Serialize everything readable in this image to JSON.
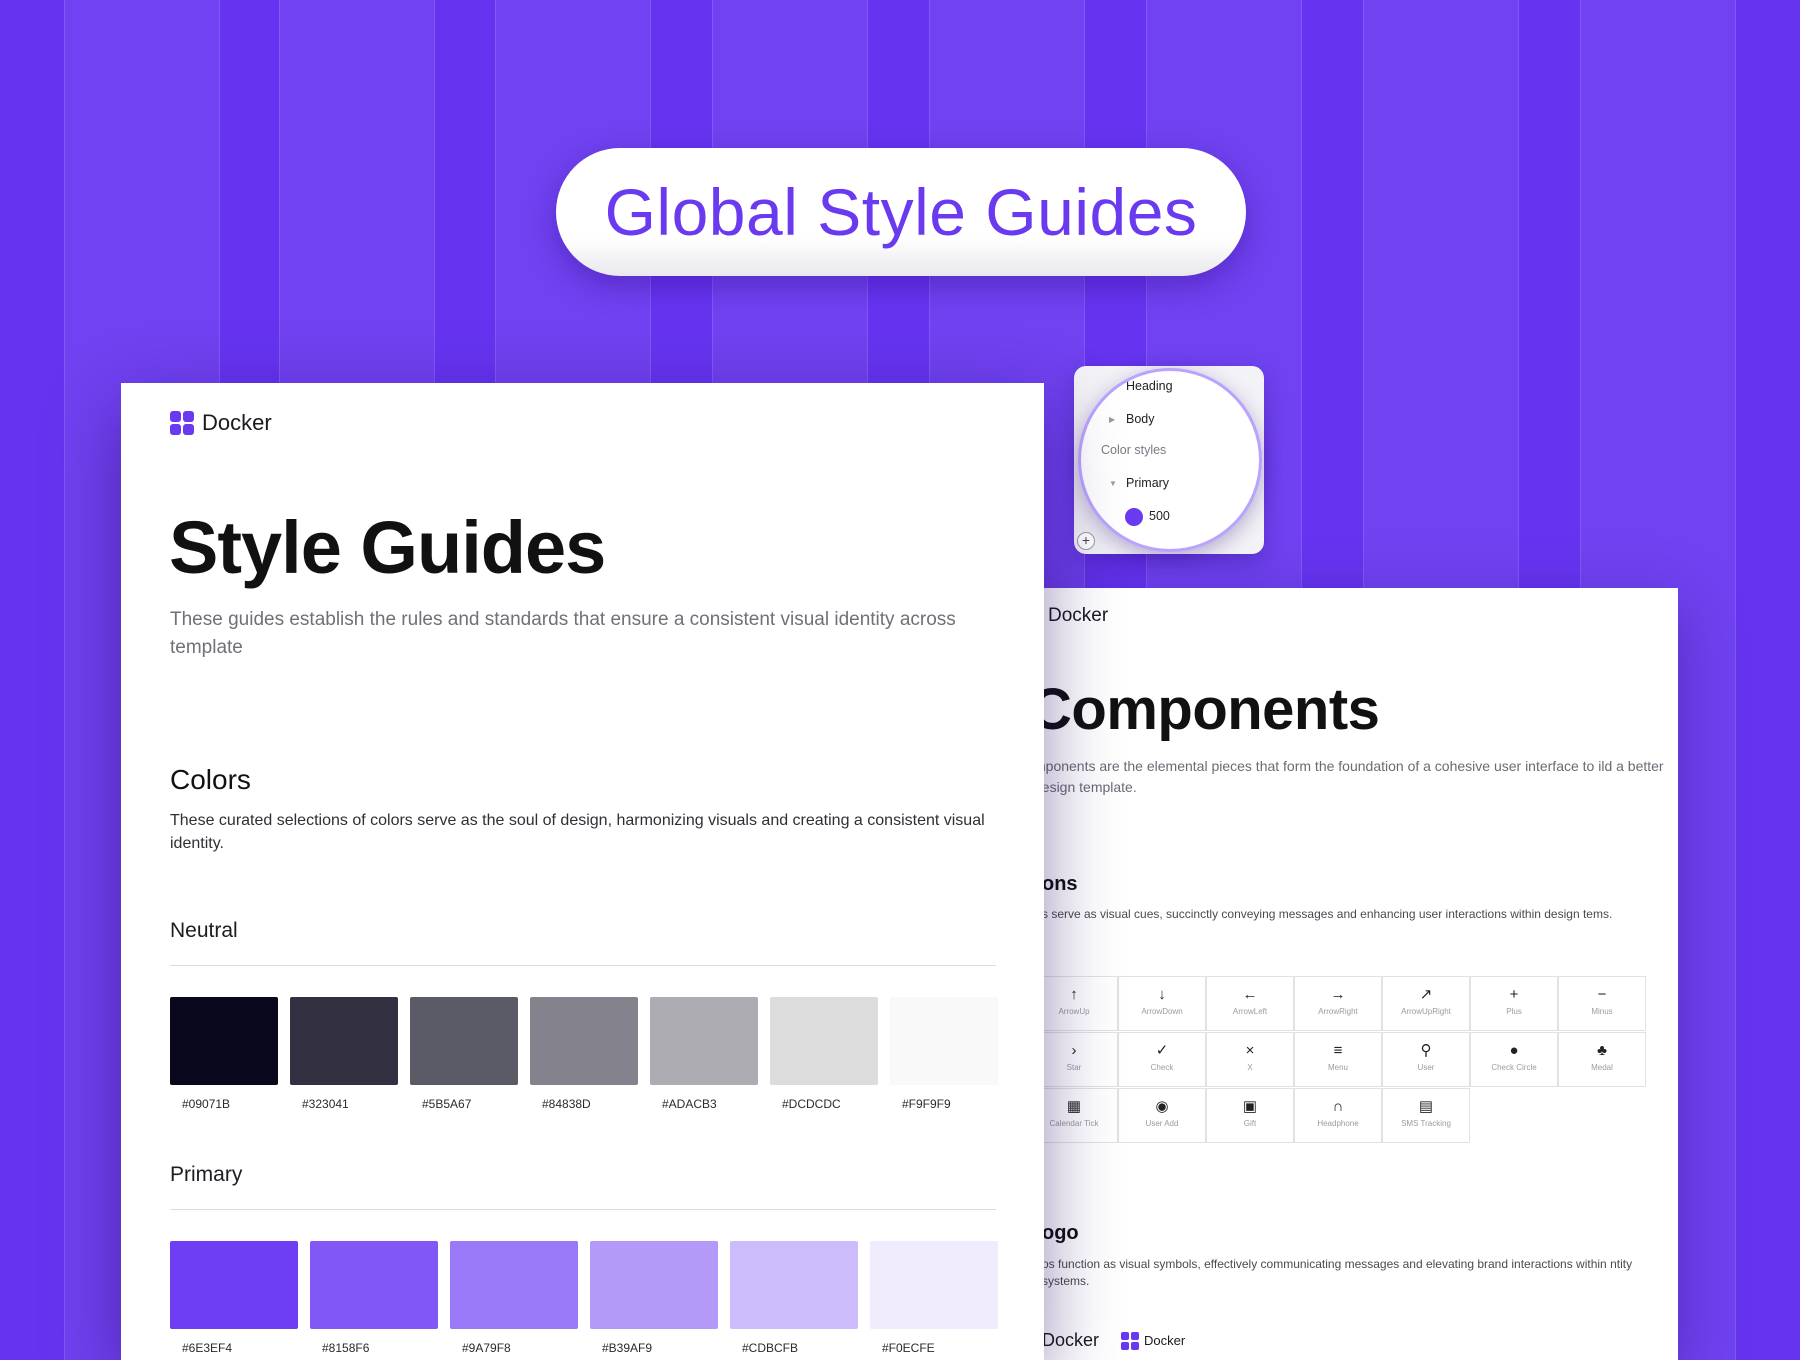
{
  "banner": {
    "title": "Global Style Guides"
  },
  "colors": {
    "accent": "#6A3AF0",
    "background": "#6634F0"
  },
  "main_page": {
    "brand": "Docker",
    "title": "Style Guides",
    "description": "These guides establish the rules and standards that ensure a consistent visual identity across template",
    "colors_heading": "Colors",
    "colors_description": "These curated selections of colors serve as the soul of design, harmonizing visuals and creating a consistent visual identity.",
    "neutral": {
      "label": "Neutral",
      "swatches": [
        "#09071B",
        "#323041",
        "#5B5A67",
        "#84838D",
        "#ADACB3",
        "#DCDCDC",
        "#F9F9F9"
      ]
    },
    "primary": {
      "label": "Primary",
      "swatches": [
        "#6E3EF4",
        "#8158F6",
        "#9A79F8",
        "#B39AF9",
        "#CDBCFB",
        "#F0ECFE"
      ]
    }
  },
  "layers_panel": {
    "items": [
      {
        "label": "Heading",
        "icon": "none"
      },
      {
        "label": "Body",
        "icon": "caret-right-icon"
      },
      {
        "label": "Color styles",
        "icon": "none"
      },
      {
        "label": "Primary",
        "icon": "caret-down-icon"
      },
      {
        "label": "500",
        "icon": "color-dot-icon"
      }
    ],
    "add_icon": "plus-icon"
  },
  "components_page": {
    "brand": "Docker",
    "title": "Components",
    "description": "mponents are the elemental pieces that form the foundation of a cohesive user interface to ild a better design template.",
    "icons_heading": "ons",
    "icons_description": "s serve as visual cues, succinctly conveying messages and enhancing user interactions within design tems.",
    "icons": [
      {
        "glyph": "↑",
        "label": "ArrowUp"
      },
      {
        "glyph": "↓",
        "label": "ArrowDown"
      },
      {
        "glyph": "←",
        "label": "ArrowLeft"
      },
      {
        "glyph": "→",
        "label": "ArrowRight"
      },
      {
        "glyph": "↗",
        "label": "ArrowUpRight"
      },
      {
        "glyph": "+",
        "label": "Plus"
      },
      {
        "glyph": "−",
        "label": "Minus"
      },
      {
        "glyph": "›",
        "label": "Star"
      },
      {
        "glyph": "✓",
        "label": "Check"
      },
      {
        "glyph": "×",
        "label": "X"
      },
      {
        "glyph": "≡",
        "label": "Menu"
      },
      {
        "glyph": "⚲",
        "label": "User"
      },
      {
        "glyph": "●",
        "label": "Check Circle"
      },
      {
        "glyph": "♣",
        "label": "Medal"
      },
      {
        "glyph": "▦",
        "label": "Calendar Tick"
      },
      {
        "glyph": "◉",
        "label": "User Add"
      },
      {
        "glyph": "▣",
        "label": "Gift"
      },
      {
        "glyph": "∩",
        "label": "Headphone"
      },
      {
        "glyph": "▤",
        "label": "SMS Tracking"
      }
    ],
    "logo_heading": "ogo",
    "logo_description": "os function as visual symbols, effectively communicating messages and elevating brand interactions within ntity systems.",
    "logos": [
      "Docker",
      "Docker"
    ]
  }
}
